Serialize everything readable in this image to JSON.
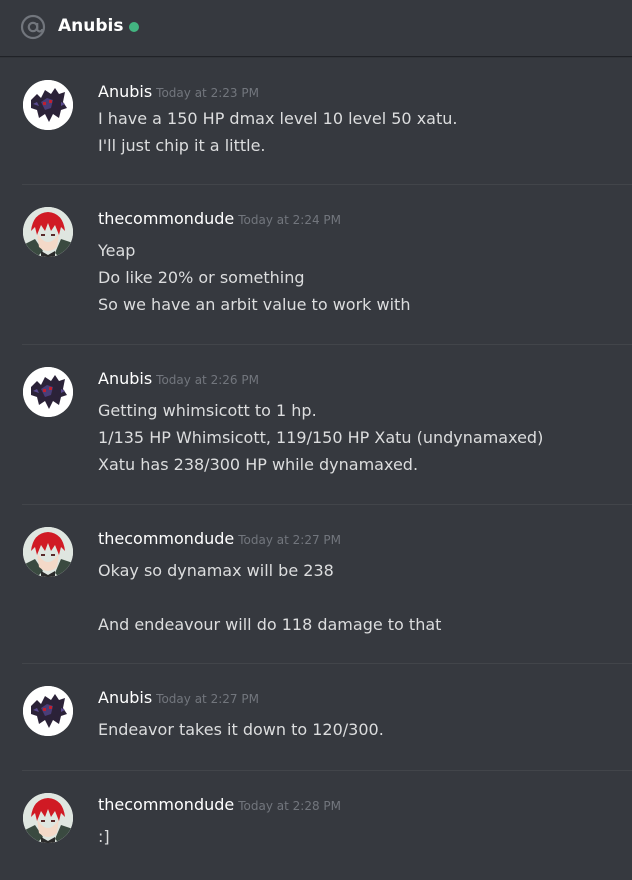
{
  "channel": {
    "title": "Anubis",
    "status_color": "#43b581",
    "icon": "at-icon"
  },
  "colors": {
    "background": "#36393f",
    "text": "#dcddde",
    "username": "#ffffff",
    "timestamp": "#72767d"
  },
  "messages": [
    {
      "author": "Anubis",
      "avatar_icon": "bat-pixel-avatar",
      "timestamp": "Today at 2:23 PM",
      "lines": [
        "I have a 150 HP dmax level 10 level 50 xatu.",
        "I'll just chip it a little."
      ]
    },
    {
      "author": "thecommondude",
      "avatar_icon": "red-hair-anime-avatar",
      "timestamp": "Today at 2:24 PM",
      "lines": [
        "Yeap",
        "Do like 20% or something",
        "So we have an arbit value to work with"
      ]
    },
    {
      "author": "Anubis",
      "avatar_icon": "bat-pixel-avatar",
      "timestamp": "Today at 2:26 PM",
      "lines": [
        "Getting whimsicott to 1 hp.",
        "1/135 HP Whimsicott, 119/150 HP Xatu (undynamaxed)",
        "Xatu has 238/300 HP while dynamaxed."
      ]
    },
    {
      "author": "thecommondude",
      "avatar_icon": "red-hair-anime-avatar",
      "timestamp": "Today at 2:27 PM",
      "lines": [
        "Okay so dynamax will be 238",
        "",
        "And endeavour will do 118 damage to that"
      ]
    },
    {
      "author": "Anubis",
      "avatar_icon": "bat-pixel-avatar",
      "timestamp": "Today at 2:27 PM",
      "lines": [
        "Endeavor takes it down to 120/300."
      ]
    },
    {
      "author": "thecommondude",
      "avatar_icon": "red-hair-anime-avatar",
      "timestamp": "Today at 2:28 PM",
      "lines": [
        ":]"
      ]
    }
  ]
}
